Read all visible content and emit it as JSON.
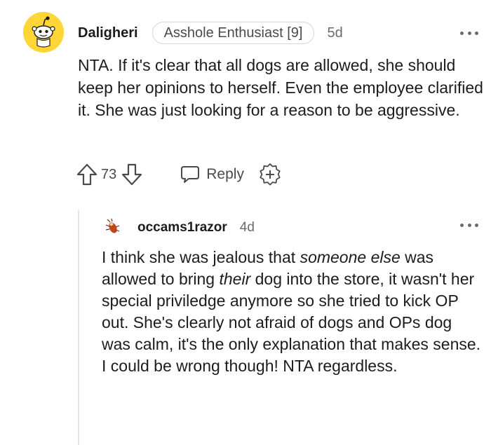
{
  "comment": {
    "username": "Daligheri",
    "flair": "Asshole Enthusiast [9]",
    "timestamp": "5d",
    "body": "NTA. If it's clear that all dogs are allowed, she should keep her opinions to herself. Even the employee clarified it. She was just looking for a reason to be aggressive.",
    "vote_count": "73",
    "reply_label": "Reply",
    "icons": {
      "avatar": "snoo-avatar-icon",
      "upvote": "upvote-arrow-icon",
      "downvote": "downvote-arrow-icon",
      "reply": "speech-bubble-icon",
      "award": "add-award-icon",
      "more": "more-options-icon"
    }
  },
  "reply": {
    "username": "occams1razor",
    "timestamp": "4d",
    "body_parts": {
      "p1": "I think she was jealous that ",
      "em1": "someone else",
      "p2": " was allowed to bring ",
      "em2": "their",
      "p3": " dog into the store, it wasn't her special priviledge anymore so she tried to kick OP out. She's clearly not afraid of dogs and OPs dog was calm, it's the only explanation that makes sense. I could be wrong though! NTA regardless."
    },
    "icons": {
      "avatar": "cockroach-avatar-icon",
      "more": "more-options-icon"
    }
  },
  "colors": {
    "avatar_bg": "#FFD635",
    "text": "#1c1c1c",
    "meta": "#6b6b6b",
    "thread_line": "#e4e4e4"
  }
}
